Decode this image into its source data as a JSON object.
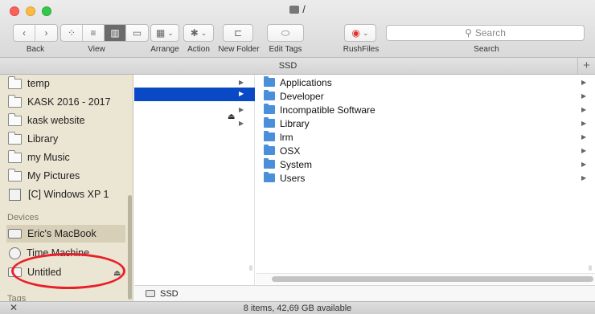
{
  "window": {
    "title": "/",
    "icon": "hard-disk-icon"
  },
  "toolbar": {
    "back_label": "Back",
    "view_label": "View",
    "arrange_label": "Arrange",
    "action_label": "Action",
    "new_folder_label": "New Folder",
    "edit_tags_label": "Edit Tags",
    "rushfiles_label": "RushFiles",
    "search_label": "Search",
    "search_placeholder": "Search"
  },
  "pathbar": {
    "title": "SSD",
    "add_glyph": "+"
  },
  "sidebar": {
    "favorites": [
      {
        "label": "temp",
        "icon": "folder-icon"
      },
      {
        "label": "KASK 2016 - 2017",
        "icon": "folder-icon"
      },
      {
        "label": "kask website",
        "icon": "folder-icon"
      },
      {
        "label": "Library",
        "icon": "folder-icon"
      },
      {
        "label": "my Music",
        "icon": "folder-icon"
      },
      {
        "label": "My Pictures",
        "icon": "folder-icon"
      },
      {
        "label": "[C] Windows XP 1",
        "icon": "virtual-machine-icon"
      }
    ],
    "devices_heading": "Devices",
    "devices": [
      {
        "label": "Eric's MacBook",
        "icon": "laptop-icon",
        "selected": true
      },
      {
        "label": "Time Machine",
        "icon": "time-machine-icon"
      },
      {
        "label": "Untitled",
        "icon": "hard-disk-icon"
      }
    ],
    "tags_heading": "Tags"
  },
  "columns": {
    "col2_items": [
      {
        "label": "Applications"
      },
      {
        "label": "Developer"
      },
      {
        "label": "Incompatible Software"
      },
      {
        "label": "Library"
      },
      {
        "label": "lrm"
      },
      {
        "label": "OSX"
      },
      {
        "label": "System"
      },
      {
        "label": "Users"
      }
    ]
  },
  "bottom_path": {
    "label": "SSD"
  },
  "status": {
    "text": "8 items, 42,69 GB available",
    "close_glyph": "✕"
  },
  "colors": {
    "selection": "#0a49c6",
    "sidebar_bg": "#ebe5d3",
    "annotation": "#e8202a",
    "folder_blue": "#4a8fd9"
  }
}
